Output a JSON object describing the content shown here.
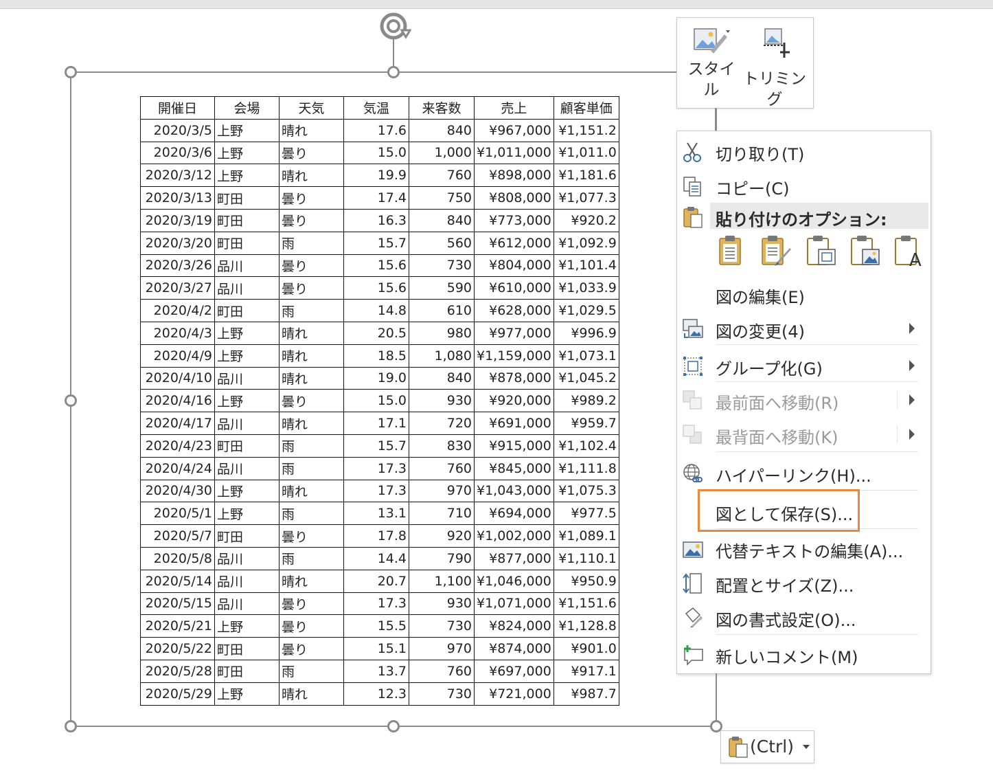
{
  "table": {
    "headers": [
      "開催日",
      "会場",
      "天気",
      "気温",
      "来客数",
      "売上",
      "顧客単価"
    ],
    "rows": [
      [
        "2020/3/5",
        "上野",
        "晴れ",
        "17.6",
        "840",
        "¥967,000",
        "¥1,151.2"
      ],
      [
        "2020/3/6",
        "上野",
        "曇り",
        "15.0",
        "1,000",
        "¥1,011,000",
        "¥1,011.0"
      ],
      [
        "2020/3/12",
        "上野",
        "晴れ",
        "19.9",
        "760",
        "¥898,000",
        "¥1,181.6"
      ],
      [
        "2020/3/13",
        "町田",
        "曇り",
        "17.4",
        "750",
        "¥808,000",
        "¥1,077.3"
      ],
      [
        "2020/3/19",
        "町田",
        "曇り",
        "16.3",
        "840",
        "¥773,000",
        "¥920.2"
      ],
      [
        "2020/3/20",
        "町田",
        "雨",
        "15.7",
        "560",
        "¥612,000",
        "¥1,092.9"
      ],
      [
        "2020/3/26",
        "品川",
        "曇り",
        "15.6",
        "730",
        "¥804,000",
        "¥1,101.4"
      ],
      [
        "2020/3/27",
        "品川",
        "曇り",
        "15.6",
        "590",
        "¥610,000",
        "¥1,033.9"
      ],
      [
        "2020/4/2",
        "町田",
        "雨",
        "14.8",
        "610",
        "¥628,000",
        "¥1,029.5"
      ],
      [
        "2020/4/3",
        "上野",
        "晴れ",
        "20.5",
        "980",
        "¥977,000",
        "¥996.9"
      ],
      [
        "2020/4/9",
        "上野",
        "晴れ",
        "18.5",
        "1,080",
        "¥1,159,000",
        "¥1,073.1"
      ],
      [
        "2020/4/10",
        "品川",
        "晴れ",
        "19.0",
        "840",
        "¥878,000",
        "¥1,045.2"
      ],
      [
        "2020/4/16",
        "上野",
        "曇り",
        "15.0",
        "930",
        "¥920,000",
        "¥989.2"
      ],
      [
        "2020/4/17",
        "品川",
        "晴れ",
        "17.1",
        "720",
        "¥691,000",
        "¥959.7"
      ],
      [
        "2020/4/23",
        "町田",
        "雨",
        "15.7",
        "830",
        "¥915,000",
        "¥1,102.4"
      ],
      [
        "2020/4/24",
        "品川",
        "雨",
        "17.3",
        "760",
        "¥845,000",
        "¥1,111.8"
      ],
      [
        "2020/4/30",
        "上野",
        "晴れ",
        "17.3",
        "970",
        "¥1,043,000",
        "¥1,075.3"
      ],
      [
        "2020/5/1",
        "上野",
        "雨",
        "13.1",
        "710",
        "¥694,000",
        "¥977.5"
      ],
      [
        "2020/5/7",
        "町田",
        "曇り",
        "17.8",
        "920",
        "¥1,002,000",
        "¥1,089.1"
      ],
      [
        "2020/5/8",
        "品川",
        "雨",
        "14.4",
        "790",
        "¥877,000",
        "¥1,110.1"
      ],
      [
        "2020/5/14",
        "品川",
        "晴れ",
        "20.7",
        "1,100",
        "¥1,046,000",
        "¥950.9"
      ],
      [
        "2020/5/15",
        "品川",
        "曇り",
        "17.3",
        "930",
        "¥1,071,000",
        "¥1,151.6"
      ],
      [
        "2020/5/21",
        "上野",
        "曇り",
        "15.5",
        "730",
        "¥824,000",
        "¥1,128.8"
      ],
      [
        "2020/5/22",
        "町田",
        "曇り",
        "15.1",
        "970",
        "¥874,000",
        "¥901.0"
      ],
      [
        "2020/5/28",
        "町田",
        "雨",
        "13.7",
        "760",
        "¥697,000",
        "¥917.1"
      ],
      [
        "2020/5/29",
        "上野",
        "晴れ",
        "12.3",
        "730",
        "¥721,000",
        "¥987.7"
      ]
    ]
  },
  "minibar": {
    "style_label_1": "スタイ",
    "style_label_2": "ル",
    "trim_label": "トリミング"
  },
  "context_menu": {
    "cut": "切り取り(T)",
    "copy": "コピー(C)",
    "paste_options": "貼り付けのオプション:",
    "edit_picture": "図の編集(E)",
    "change_picture": "図の変更(4)",
    "group": "グループ化(G)",
    "bring_front": "最前面へ移動(R)",
    "send_back": "最背面へ移動(K)",
    "hyperlink": "ハイパーリンク(H)...",
    "save_as_picture": "図として保存(S)...",
    "edit_alt_text": "代替テキストの編集(A)...",
    "size_position": "配置とサイズ(Z)...",
    "format_picture": "図の書式設定(O)...",
    "new_comment": "新しいコメント(M)"
  },
  "ctrl_paste": {
    "label": "(Ctrl)"
  },
  "colors": {
    "highlight": "#e8883a",
    "handle": "#8a8a8a",
    "disabled": "#9a9a9a"
  }
}
